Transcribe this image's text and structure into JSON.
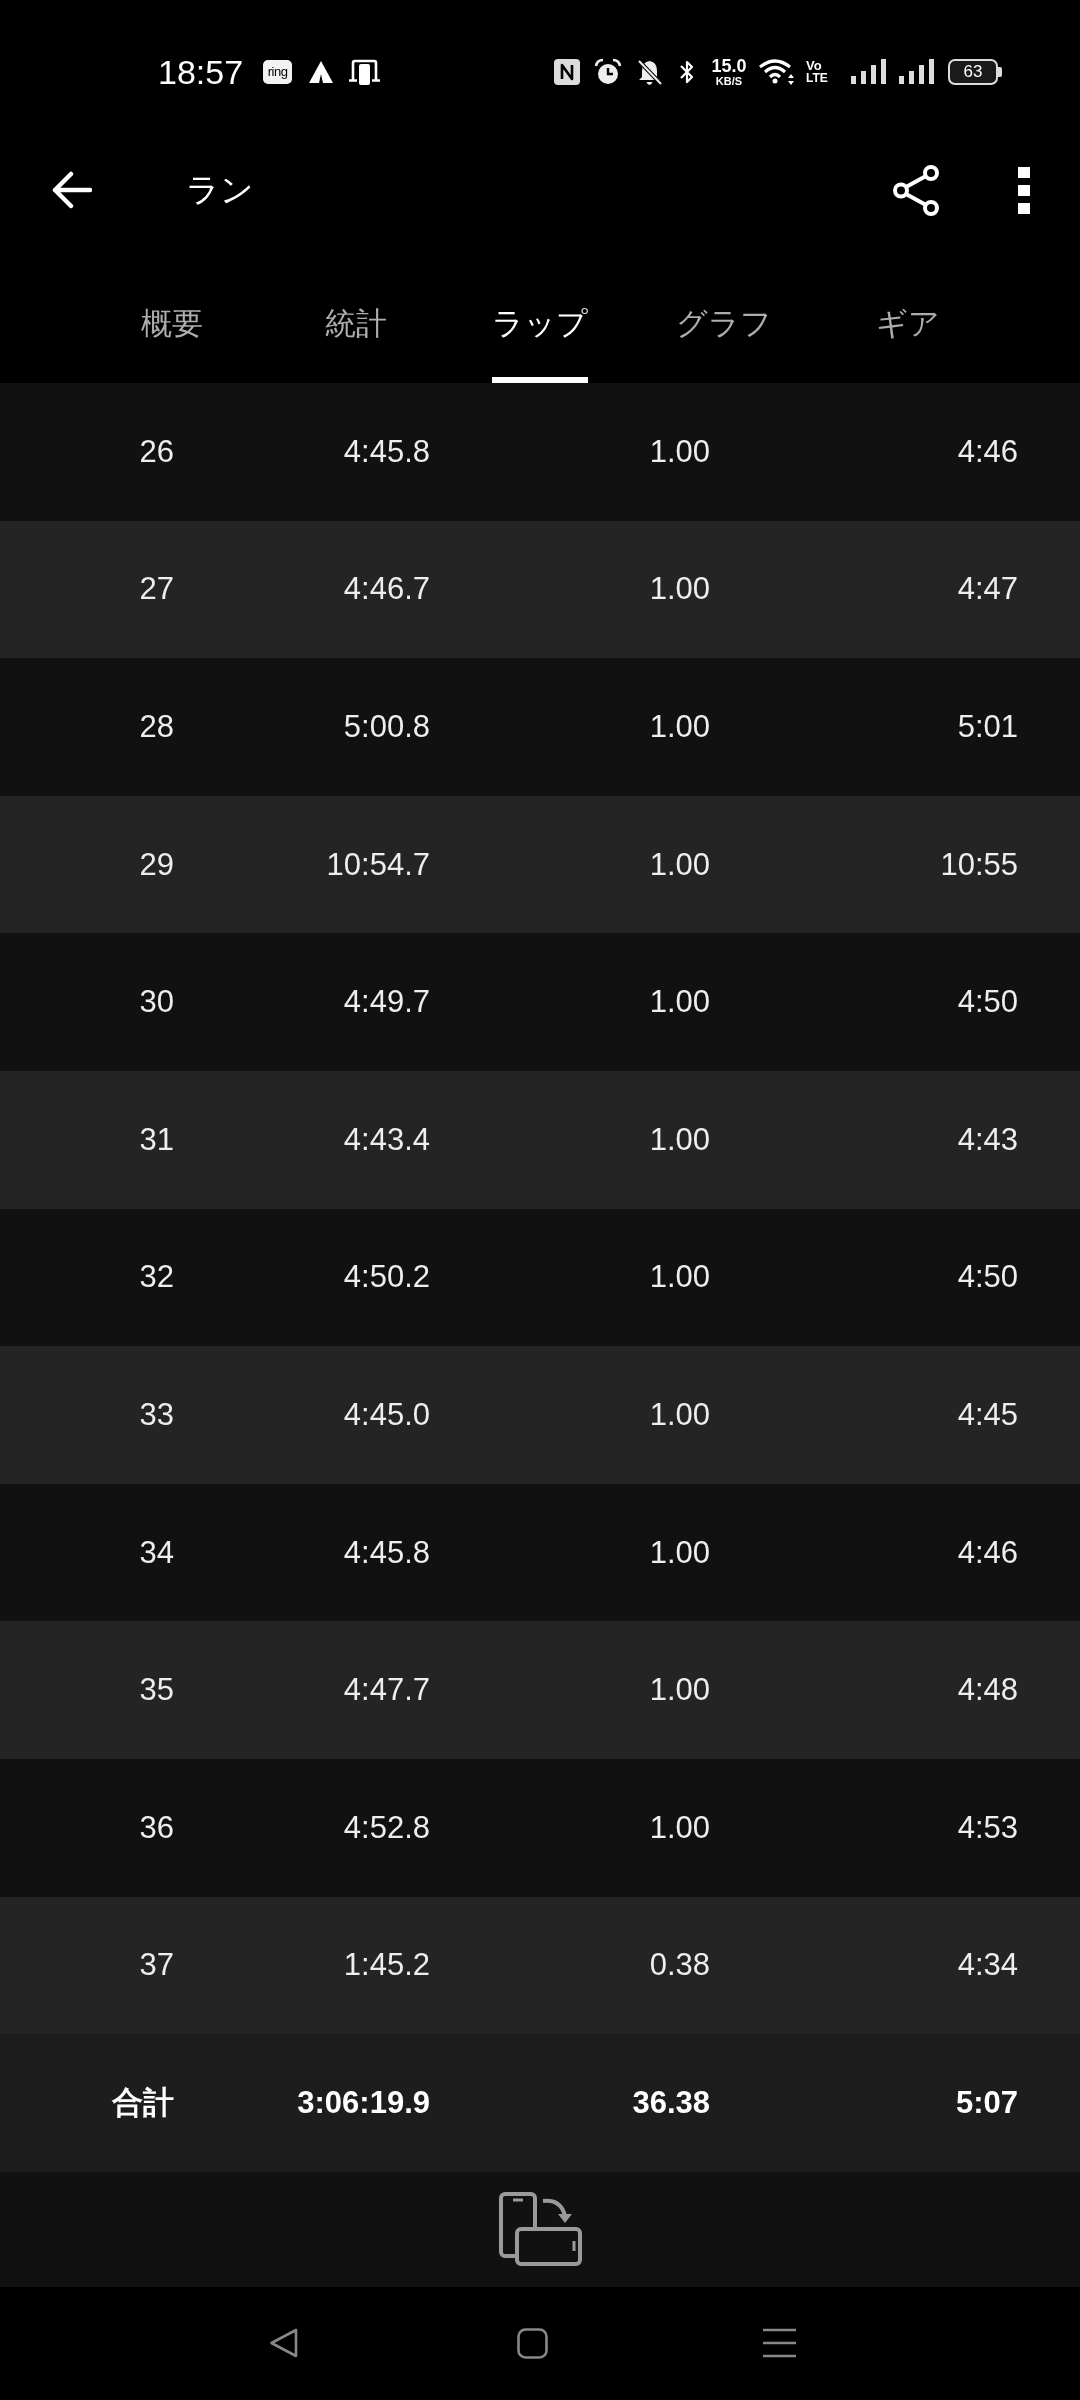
{
  "status_bar": {
    "time": "18:57",
    "app_badge": "ring",
    "network_speed": {
      "value": "15.0",
      "unit": "KB/S"
    },
    "network_type": {
      "top": "Vo",
      "bottom": "LTE"
    },
    "battery": "63"
  },
  "toolbar": {
    "title": "ラン"
  },
  "tabs": [
    {
      "label": "概要",
      "selected": false
    },
    {
      "label": "統計",
      "selected": false
    },
    {
      "label": "ラップ",
      "selected": true
    },
    {
      "label": "グラフ",
      "selected": false
    },
    {
      "label": "ギア",
      "selected": false
    }
  ],
  "lap_table": {
    "rows": [
      [
        "26",
        "4:45.8",
        "1.00",
        "4:46"
      ],
      [
        "27",
        "4:46.7",
        "1.00",
        "4:47"
      ],
      [
        "28",
        "5:00.8",
        "1.00",
        "5:01"
      ],
      [
        "29",
        "10:54.7",
        "1.00",
        "10:55"
      ],
      [
        "30",
        "4:49.7",
        "1.00",
        "4:50"
      ],
      [
        "31",
        "4:43.4",
        "1.00",
        "4:43"
      ],
      [
        "32",
        "4:50.2",
        "1.00",
        "4:50"
      ],
      [
        "33",
        "4:45.0",
        "1.00",
        "4:45"
      ],
      [
        "34",
        "4:45.8",
        "1.00",
        "4:46"
      ],
      [
        "35",
        "4:47.7",
        "1.00",
        "4:48"
      ],
      [
        "36",
        "4:52.8",
        "1.00",
        "4:53"
      ],
      [
        "37",
        "1:45.2",
        "0.38",
        "4:34"
      ]
    ],
    "total": [
      "合計",
      "3:06:19.9",
      "36.38",
      "5:07"
    ]
  }
}
